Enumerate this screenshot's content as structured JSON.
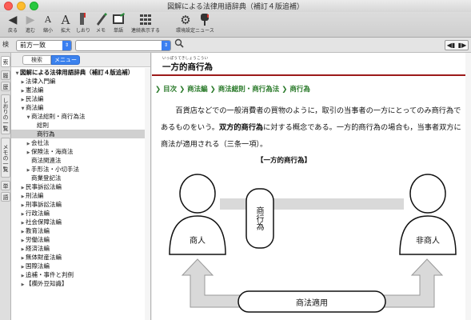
{
  "window": {
    "title": "図解による法律用語辞典（補訂４版追補）"
  },
  "toolbar": {
    "back_label": "戻る",
    "forward_label": "進む",
    "shrink_label": "縮小",
    "enlarge_label": "拡大",
    "bookmark_label": "しおり",
    "memo_label": "メモ",
    "wordbook_label": "単語",
    "continuous_label": "連続表示する",
    "settings_label": "環境設定",
    "news_label": "ニュース"
  },
  "search": {
    "match_mode": "前方一致",
    "query": ""
  },
  "side_tabs": {
    "top": "検",
    "items": [
      "索",
      "履",
      "歴",
      "しおりの一覧",
      "メモの一覧",
      "単",
      "語"
    ]
  },
  "tree": {
    "tab_search": "検索",
    "tab_menu": "メニュー",
    "items": [
      {
        "label": "図解による法律用語辞典（補訂４版追補）",
        "indent": 0,
        "open": true,
        "bold": true
      },
      {
        "label": "法律入門編",
        "indent": 1,
        "open": false
      },
      {
        "label": "憲法編",
        "indent": 1,
        "open": false
      },
      {
        "label": "民法編",
        "indent": 1,
        "open": false
      },
      {
        "label": "商法編",
        "indent": 1,
        "open": true
      },
      {
        "label": "商法総則・商行為法",
        "indent": 2,
        "open": true
      },
      {
        "label": "総則",
        "indent": 3,
        "leaf": true
      },
      {
        "label": "商行為",
        "indent": 3,
        "leaf": true,
        "selected": true
      },
      {
        "label": "会社法",
        "indent": 2,
        "open": false
      },
      {
        "label": "保険法・海商法",
        "indent": 2,
        "open": false
      },
      {
        "label": "商法関連法",
        "indent": 2,
        "leaf": true
      },
      {
        "label": "手形法・小切手法",
        "indent": 2,
        "open": false
      },
      {
        "label": "商業登記法",
        "indent": 2,
        "leaf": true
      },
      {
        "label": "民事訴訟法編",
        "indent": 1,
        "open": false
      },
      {
        "label": "刑法編",
        "indent": 1,
        "open": false
      },
      {
        "label": "刑事訴訟法編",
        "indent": 1,
        "open": false
      },
      {
        "label": "行政法編",
        "indent": 1,
        "open": false
      },
      {
        "label": "社会保障法編",
        "indent": 1,
        "open": false
      },
      {
        "label": "教育法編",
        "indent": 1,
        "open": false
      },
      {
        "label": "労働法編",
        "indent": 1,
        "open": false
      },
      {
        "label": "経済法編",
        "indent": 1,
        "open": false
      },
      {
        "label": "無体財産法編",
        "indent": 1,
        "open": false
      },
      {
        "label": "国際法編",
        "indent": 1,
        "open": false
      },
      {
        "label": "追補・事件と判例",
        "indent": 1,
        "open": false
      },
      {
        "label": "【欄外豆知識】",
        "indent": 1,
        "open": false
      }
    ]
  },
  "entry": {
    "ruby": "いっぽうてきしょうこうい",
    "title": "一方的商行為",
    "breadcrumb": [
      "目次",
      "商法編",
      "商法総則・商行為法",
      "商行為"
    ],
    "body_part1": "百貨店などでの一般消費者の買物のように，取引の当事者の一方にとってのみ商行為であるものをいう。",
    "body_bold": "双方的商行為",
    "body_part2": "に対する概念である。一方的商行為の場合も，当事者双方に商法が適用される（三条一項）。",
    "figure": {
      "caption": "【一方的商行為】",
      "left_person": "商人",
      "right_person": "非商人",
      "center_label": "商行為",
      "bottom_label": "商法適用"
    }
  }
}
